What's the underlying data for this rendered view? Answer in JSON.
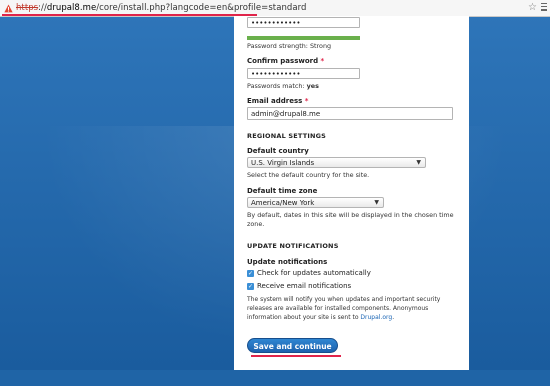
{
  "browser": {
    "url_protocol": "https",
    "url_separator": "://",
    "url_domain": "drupal8.me",
    "url_path": "/core/install.php?langcode=en&profile=standard"
  },
  "form": {
    "password": {
      "value": "••••••••••••",
      "strength_fraction": 1.0,
      "strength_text": "Password strength: Strong"
    },
    "confirm_password": {
      "label": "Confirm password",
      "required_marker": "*",
      "value": "••••••••••••",
      "match_text_prefix": "Passwords match:",
      "match_value": "yes"
    },
    "email": {
      "label": "Email address",
      "required_marker": "*",
      "value": "admin@drupal8.me"
    },
    "regional": {
      "heading": "REGIONAL SETTINGS",
      "country_label": "Default country",
      "country_value": "U.S. Virgin Islands",
      "country_desc": "Select the default country for the site.",
      "timezone_label": "Default time zone",
      "timezone_value": "America/New York",
      "timezone_desc": "By default, dates in this site will be displayed in the chosen time zone."
    },
    "updates": {
      "heading": "UPDATE NOTIFICATIONS",
      "group_label": "Update notifications",
      "check_updates_label": "Check for updates automatically",
      "email_notify_label": "Receive email notifications",
      "desc_part1": "The system will notify you when updates and important security releases are available for installed components. Anonymous information about your site is sent to ",
      "desc_link": "Drupal.org",
      "desc_part2": "."
    },
    "submit_label": "Save and continue"
  },
  "colors": {
    "accent_blue": "#1d61ad",
    "strength_bar": "#6ab04c",
    "annotation_red": "#e0244a"
  }
}
